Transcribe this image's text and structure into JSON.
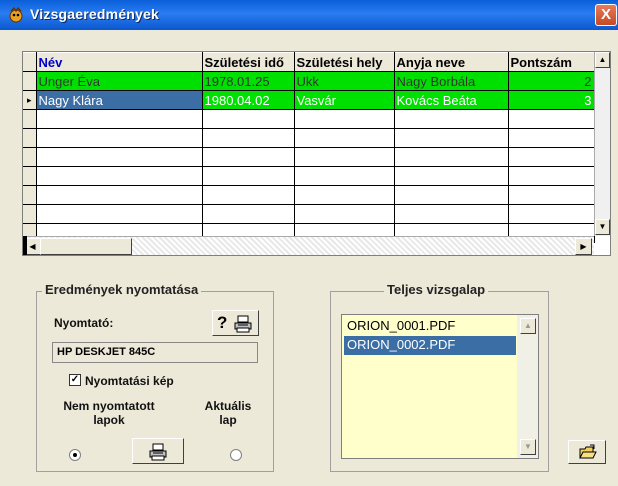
{
  "window": {
    "title": "Vizsgaeredmények",
    "close_label": "X"
  },
  "grid": {
    "columns": [
      "Név",
      "Születési idő",
      "Születési hely",
      "Anyja neve",
      "Pontszám"
    ],
    "rows": [
      {
        "nev": "Unger Éva",
        "szul_ido": "1978.01.25",
        "szul_hely": "Ukk",
        "anyja": "Nagy Borbála",
        "pont": "2"
      },
      {
        "nev": "Nagy Klára",
        "szul_ido": "1980.04.02",
        "szul_hely": "Vasvár",
        "anyja": "Kovács Beáta",
        "pont": "3"
      }
    ],
    "current_row_marker": "▸"
  },
  "print_group": {
    "title": "Eredmények nyomtatása",
    "printer_label": "Nyomtató:",
    "printer_help_symbol": "?",
    "printer_name": "HP DESKJET 845C",
    "preview_checkbox_label": "Nyomtatási kép",
    "preview_checked": true,
    "option_unprinted": "Nem nyomtatott lapok",
    "option_current": "Aktuális lap",
    "selected_option": "unprinted"
  },
  "full_sheet_group": {
    "title": "Teljes vizsgalap",
    "files": [
      "ORION_0001.PDF",
      "ORION_0002.PDF"
    ],
    "selected_file_index": 1
  },
  "icons": {
    "window": "app-icon",
    "print": "printer-icon",
    "open_folder": "open-folder-icon"
  },
  "colors": {
    "title_bar": "#0a5fd9",
    "row_highlight": "#00e000",
    "selection": "#3a6ea5",
    "list_background": "#ffffcc",
    "window_background": "#ece9d8"
  }
}
